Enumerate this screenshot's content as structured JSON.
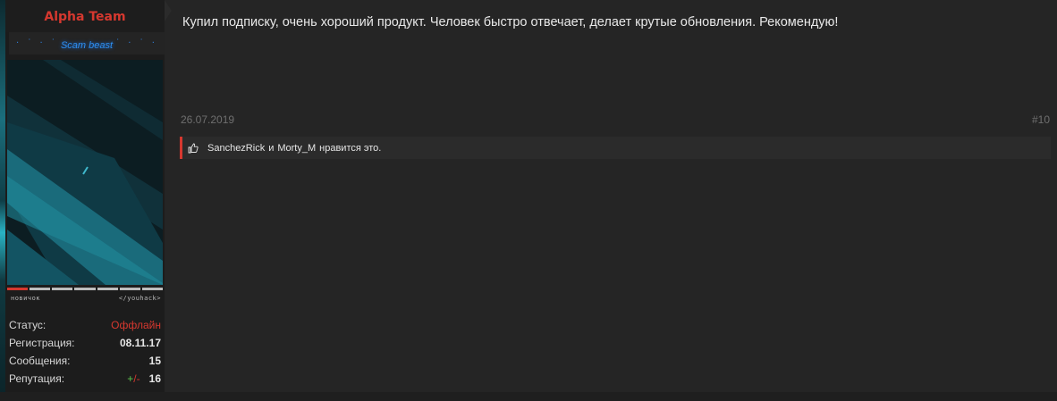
{
  "user": {
    "name": "Alpha Team",
    "title": "Scam beast",
    "rank_levels": [
      "новичок",
      "</youhack>"
    ],
    "rank_progress": 0.14
  },
  "stats": [
    {
      "label": "Статус:",
      "value": "Оффлайн"
    },
    {
      "label": "Регистрация:",
      "value": "08.11.17"
    },
    {
      "label": "Сообщения:",
      "value": "15"
    },
    {
      "label": "Репутация:",
      "plus": "+",
      "slash": "/",
      "minus": "-",
      "value": "16"
    }
  ],
  "post": {
    "text": "Купил подписку, очень хороший продукт. Человек быстро отвечает, делает крутые обновления. Рекомендую!",
    "date": "26.07.2019",
    "number": "#10"
  },
  "likes": {
    "user1": "SanchezRick",
    "conjunction": "и",
    "user2": "Morty_M",
    "suffix": "нравится это."
  },
  "colors": {
    "accent": "#d6382f",
    "title_glow": "#2e8ff0",
    "background": "#252525"
  },
  "icons": {
    "like": "thumbs-up-icon"
  }
}
